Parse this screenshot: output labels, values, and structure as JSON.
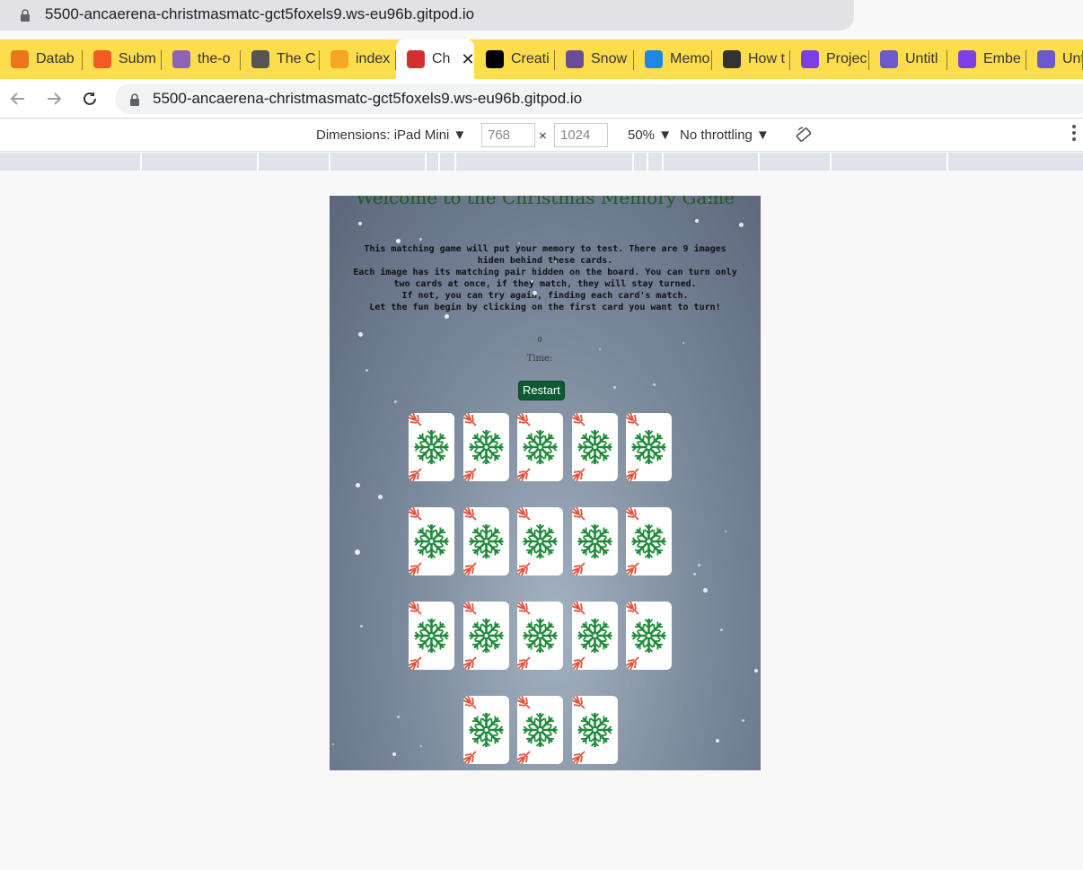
{
  "ghost_bar": {
    "url": "5500-ancaerena-christmasmatc-gct5foxels9.ws-eu96b.gitpod.io"
  },
  "tabs": [
    {
      "label": "Datab",
      "icon": "database-icon",
      "color": "#e8761a"
    },
    {
      "label": "Subm",
      "icon": "submit-icon",
      "color": "#f15a24"
    },
    {
      "label": "the-o",
      "icon": "heroku-icon",
      "color": "#8e63b5"
    },
    {
      "label": "The C",
      "icon": "globe-icon",
      "color": "#555555"
    },
    {
      "label": "index",
      "icon": "gitpod-icon",
      "color": "#f5a623"
    },
    {
      "label": "Ch",
      "icon": "santa-icon",
      "color": "#d32f2f",
      "active": true
    },
    {
      "label": "Creati",
      "icon": "dev-icon",
      "color": "#000000"
    },
    {
      "label": "Snow",
      "icon": "bee-icon",
      "color": "#6b4c9a"
    },
    {
      "label": "Memo",
      "icon": "codeanywhere-icon",
      "color": "#1e88e5"
    },
    {
      "label": "How t",
      "icon": "ah-icon",
      "color": "#333333"
    },
    {
      "label": "Projec",
      "icon": "canva-icon",
      "color": "#7b3fe4"
    },
    {
      "label": "Untitl",
      "icon": "printer-icon",
      "color": "#6a5acd"
    },
    {
      "label": "Embe",
      "icon": "canva-icon",
      "color": "#7b3fe4"
    },
    {
      "label": "Untit",
      "icon": "printer-icon",
      "color": "#6a5acd"
    }
  ],
  "tab_close": "✕",
  "omnibox": {
    "url": "5500-ancaerena-christmasmatc-gct5foxels9.ws-eu96b.gitpod.io"
  },
  "devtools": {
    "dimensions_label": "Dimensions: iPad Mini ▼",
    "width": "768",
    "times": "×",
    "height": "1024",
    "zoom": "50% ▼",
    "throttling": "No throttling ▼"
  },
  "game": {
    "title": "Welcome to the Christmas Memory Game",
    "intro": [
      "This matching game will put your memory to test. There are 9 images",
      "hiden behind these cards.",
      "Each image has its matching pair hidden on the board. You can turn only",
      "two cards at once, if they match, they will stay turned.",
      "If not, you can try again, finding each card's match.",
      "Let the fun begin by clicking on the first card you want to turn!"
    ],
    "moves": "0",
    "timer_label": "Time:",
    "restart_label": "Restart",
    "card_count": 18,
    "colors": {
      "snowflake": "#1e8a3a",
      "corner": "#e2533a",
      "restart_bg": "#0d5b32",
      "title": "#1b5e20"
    }
  }
}
